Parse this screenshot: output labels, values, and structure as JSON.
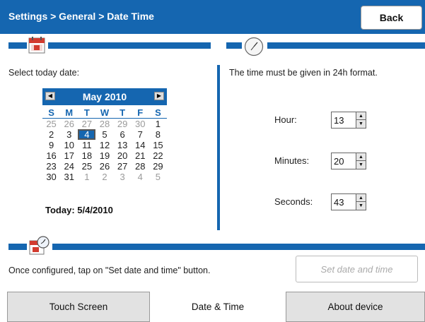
{
  "header": {
    "breadcrumb": "Settings > General > Date Time",
    "back_label": "Back"
  },
  "date_panel": {
    "prompt": "Select today date:",
    "calendar": {
      "month_label": "May 2010",
      "weekdays": [
        "S",
        "M",
        "T",
        "W",
        "T",
        "F",
        "S"
      ],
      "weeks": [
        [
          "25",
          "26",
          "27",
          "28",
          "29",
          "30",
          "1"
        ],
        [
          "2",
          "3",
          "4",
          "5",
          "6",
          "7",
          "8"
        ],
        [
          "9",
          "10",
          "11",
          "12",
          "13",
          "14",
          "15"
        ],
        [
          "16",
          "17",
          "18",
          "19",
          "20",
          "21",
          "22"
        ],
        [
          "23",
          "24",
          "25",
          "26",
          "27",
          "28",
          "29"
        ],
        [
          "30",
          "31",
          "1",
          "2",
          "3",
          "4",
          "5"
        ]
      ],
      "selected_day": "4"
    },
    "today_label": "Today: 5/4/2010"
  },
  "time_panel": {
    "note": "The time must be given in 24h format.",
    "hour": {
      "label": "Hour:",
      "value": "13"
    },
    "minutes": {
      "label": "Minutes:",
      "value": "20"
    },
    "seconds": {
      "label": "Seconds:",
      "value": "43"
    }
  },
  "footer": {
    "instruction": "Once configured, tap on \"Set date and time\" button.",
    "set_button_label": "Set date and time"
  },
  "tabs": [
    {
      "label": "Touch Screen",
      "active": false
    },
    {
      "label": "Date & Time",
      "active": true
    },
    {
      "label": "About device",
      "active": false
    }
  ],
  "colors": {
    "accent": "#1566b0",
    "tab_inactive": "#e2e2e2",
    "disabled_text": "#aaaaaa"
  },
  "icons": {
    "date_section": "calendar-icon",
    "time_section": "clock-icon",
    "footer_section": "calendar-clock-icon"
  }
}
